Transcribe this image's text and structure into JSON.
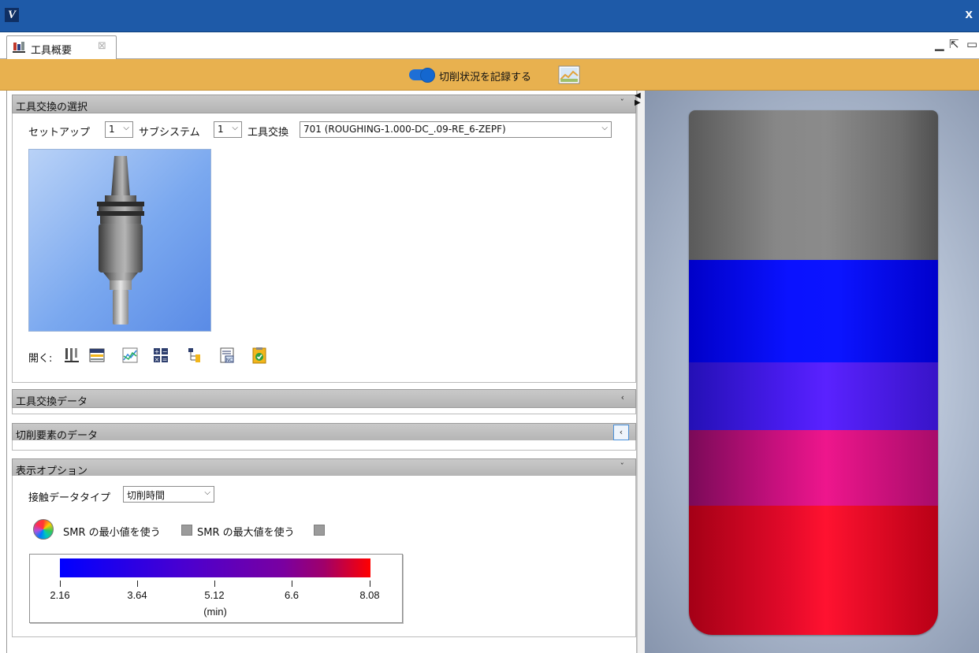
{
  "window": {
    "logo": "V",
    "close": "x"
  },
  "tab": {
    "label": "工具概要",
    "close": "⊠"
  },
  "window_controls": {
    "minimize": "▁",
    "popout": "⇱",
    "maximize": "▭"
  },
  "header": {
    "toggle_label": "切削状況を記録する",
    "toggle_on": true
  },
  "sections": {
    "tool_change_selection": {
      "title": "工具交換の選択",
      "setup_label": "セットアップ",
      "setup_value": "1",
      "subsystem_label": "サブシステム",
      "subsystem_value": "1",
      "tool_change_label": "工具交換",
      "tool_change_value": "701 (ROUGHING-1.000-DC_.09-RE_6-ZEPF)",
      "open_label": "開く:"
    },
    "tool_change_data": {
      "title": "工具交換データ"
    },
    "cutting_element_data": {
      "title": "切削要素のデータ"
    },
    "display_options": {
      "title": "表示オプション",
      "contact_type_label": "接触データタイプ",
      "contact_type_value": "切削時間",
      "use_min_label": "SMR の最小値を使う",
      "use_max_label": "SMR の最大値を使う",
      "use_min_checked": false,
      "use_max_checked": false
    }
  },
  "legend": {
    "ticks": [
      "2.16",
      "3.64",
      "5.12",
      "6.6",
      "8.08"
    ],
    "unit": "(min)",
    "min": 2.16,
    "max": 8.08,
    "colors": {
      "low": "#0000ff",
      "high": "#ff0000"
    }
  },
  "icons": {
    "open_tools": [
      "tool-holder-icon",
      "table-icon",
      "chart-icon",
      "calculator-icon",
      "tree-icon",
      "nc-report-icon",
      "checklist-icon"
    ],
    "snapshot": "snapshot-icon"
  },
  "colors": {
    "title_bar": "#1e5aa8",
    "header_bar": "#e8b14f",
    "toggle": "#1e6fd6"
  }
}
